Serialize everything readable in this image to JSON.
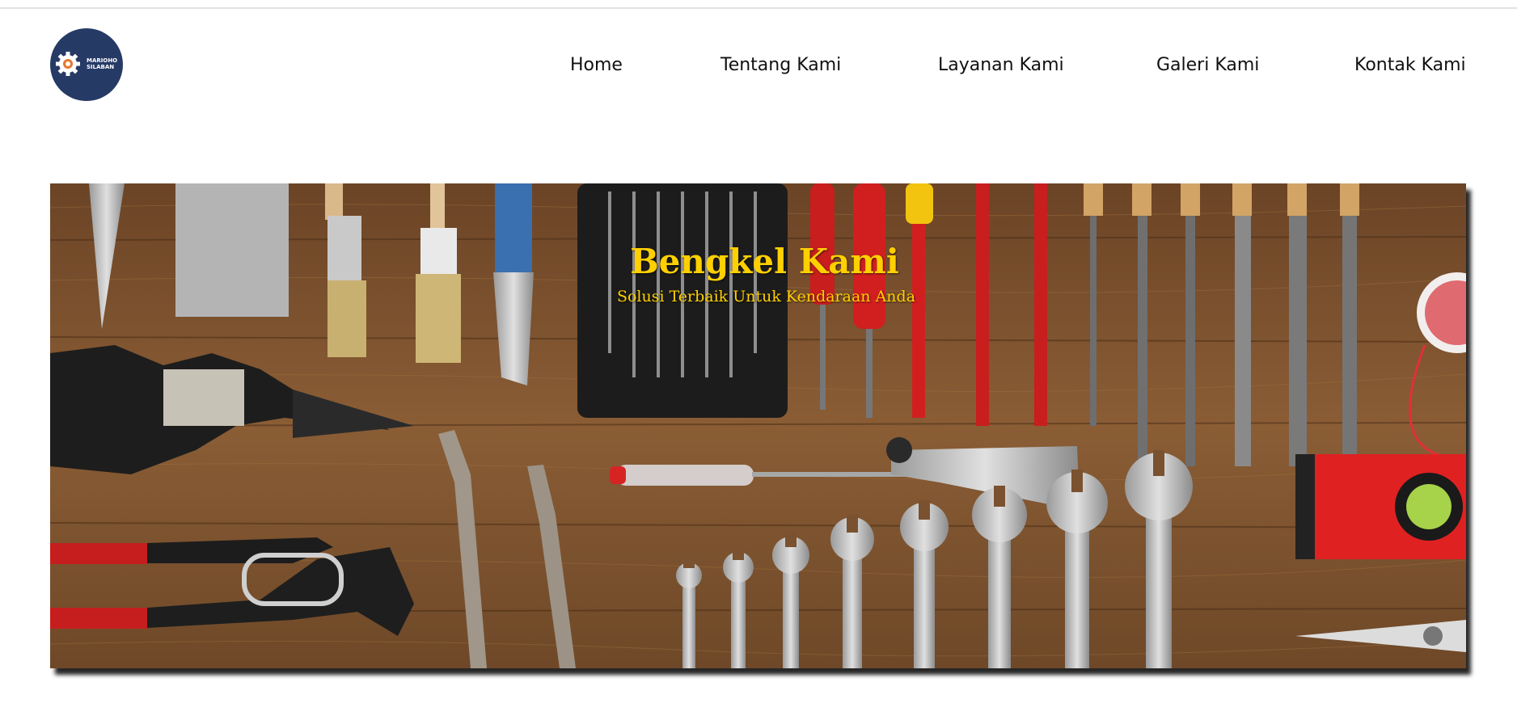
{
  "logo": {
    "text": "MARIOHO\nSILABAN",
    "color": "#263a66"
  },
  "nav": {
    "items": [
      {
        "label": "Home"
      },
      {
        "label": "Tentang Kami"
      },
      {
        "label": "Layanan Kami"
      },
      {
        "label": "Galeri Kami"
      },
      {
        "label": "Kontak Kami"
      }
    ]
  },
  "hero": {
    "title": "Bengkel Kami",
    "subtitle": "Solusi Terbaik Untuk Kendaraan Anda",
    "title_color": "#ffd000",
    "image": "tools-on-wooden-table"
  }
}
